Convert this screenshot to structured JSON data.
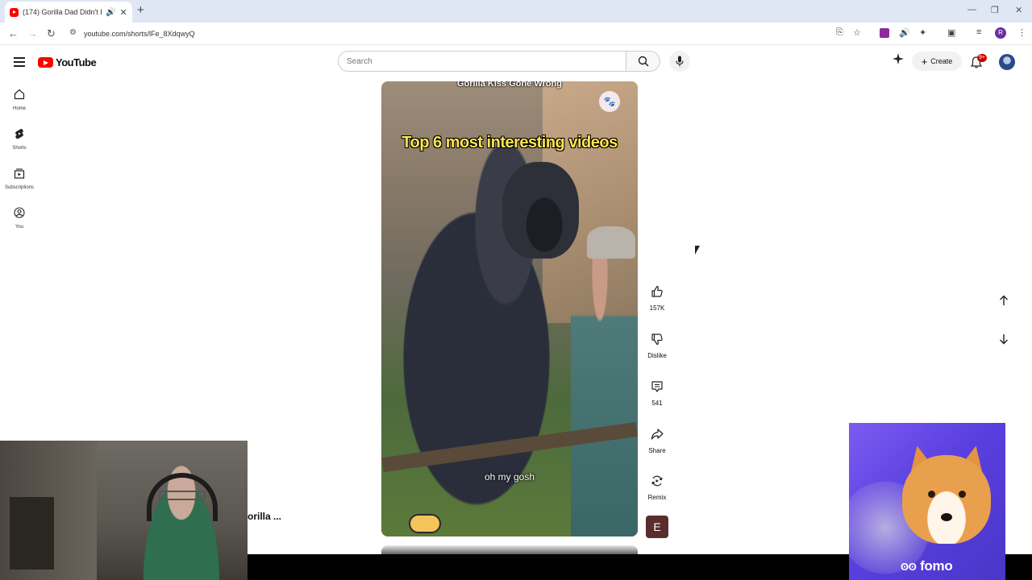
{
  "browser": {
    "tab_title": "(174) Gorilla Dad Didn't Ex",
    "url": "youtube.com/shorts/lFe_8XdqwyQ"
  },
  "masthead": {
    "logo_text": "YouTube",
    "search_placeholder": "Search",
    "create_label": "Create",
    "notification_count": "9+"
  },
  "guide": {
    "items": [
      {
        "label": "Home",
        "icon": "home-icon"
      },
      {
        "label": "Shorts",
        "icon": "shorts-icon"
      },
      {
        "label": "Subscriptions",
        "icon": "subscriptions-icon"
      },
      {
        "label": "You",
        "icon": "you-icon"
      }
    ]
  },
  "video": {
    "top_title": "Gorilla Kiss Gone Wrong",
    "headline": "Top 6 most interesting videos",
    "caption": "oh my gosh"
  },
  "actions": {
    "like_count": "157K",
    "dislike_label": "Dislike",
    "comment_count": "541",
    "share_label": "Share",
    "remix_label": "Remix",
    "channel_initial": "E"
  },
  "overlay": {
    "partial_title": "orilla ...",
    "ad_brand": "fomo"
  },
  "colors": {
    "brand_red": "#ff0000",
    "headline_yellow": "#ffe552",
    "ad_purple": "#5a3fe0"
  }
}
